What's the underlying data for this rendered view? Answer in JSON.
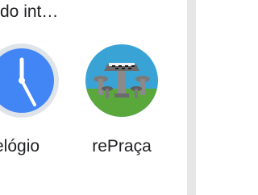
{
  "top_label": "do int…",
  "apps": [
    {
      "name": "Relógio",
      "visible_label": "elógio",
      "icon": "clock-icon"
    },
    {
      "name": "rePraça",
      "visible_label": "rePraça",
      "icon": "repraca-icon"
    }
  ],
  "colors": {
    "clock_face": "#4285f4",
    "clock_ring": "#dfe3ea",
    "repraca_sky": "#3aa3d6",
    "repraca_grass": "#5aa83c",
    "side_strip": "#e6e6e6"
  }
}
